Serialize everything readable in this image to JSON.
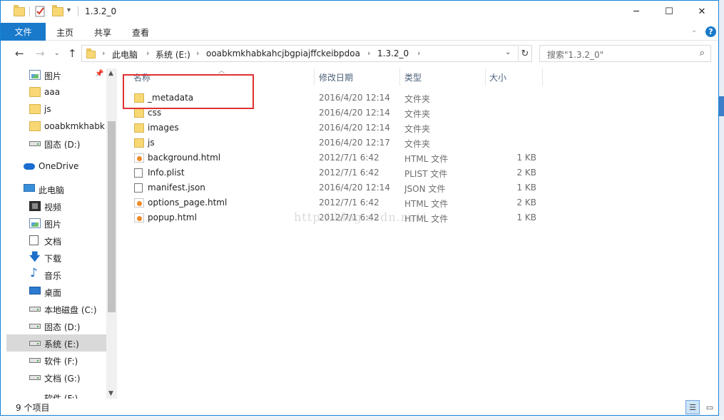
{
  "window": {
    "title": "1.3.2_0",
    "controls": {
      "minimize": "─",
      "maximize": "☐",
      "close": "✕"
    }
  },
  "ribbon": {
    "tabs": [
      "文件",
      "主页",
      "共享",
      "查看"
    ],
    "help": "?"
  },
  "address": {
    "crumbs": [
      "此电脑",
      "系统 (E:)",
      "ooabkmkhabkahcjbgpiajffckeibpdoa",
      "1.3.2_0"
    ]
  },
  "search": {
    "placeholder": "搜索\"1.3.2_0\""
  },
  "sidebar": {
    "items": [
      {
        "label": "图片",
        "icon": "pictures-icon",
        "pinned": true
      },
      {
        "label": "aaa",
        "icon": "folder-icon"
      },
      {
        "label": "js",
        "icon": "folder-icon"
      },
      {
        "label": "ooabkmkhabk",
        "icon": "folder-icon"
      },
      {
        "label": "固态 (D:)",
        "icon": "drive-icon"
      },
      {
        "label": "OneDrive",
        "icon": "onedrive-icon"
      },
      {
        "label": "此电脑",
        "icon": "this-pc-icon"
      },
      {
        "label": "视频",
        "icon": "videos-icon"
      },
      {
        "label": "图片",
        "icon": "pictures-icon"
      },
      {
        "label": "文档",
        "icon": "documents-icon"
      },
      {
        "label": "下载",
        "icon": "downloads-icon"
      },
      {
        "label": "音乐",
        "icon": "music-icon"
      },
      {
        "label": "桌面",
        "icon": "desktop-icon"
      },
      {
        "label": "本地磁盘 (C:)",
        "icon": "drive-icon"
      },
      {
        "label": "固态 (D:)",
        "icon": "drive-icon"
      },
      {
        "label": "系统 (E:)",
        "icon": "drive-icon",
        "selected": true
      },
      {
        "label": "软件 (F:)",
        "icon": "drive-icon"
      },
      {
        "label": "文档 (G:)",
        "icon": "drive-icon"
      },
      {
        "label": "软件 (F:)",
        "icon": "drive-icon"
      }
    ]
  },
  "columns": {
    "name": "名称",
    "date": "修改日期",
    "type": "类型",
    "size": "大小"
  },
  "files": [
    {
      "name": "_metadata",
      "date": "2016/4/20 12:14",
      "type": "文件夹",
      "size": "",
      "kind": "folder"
    },
    {
      "name": "css",
      "date": "2016/4/20 12:14",
      "type": "文件夹",
      "size": "",
      "kind": "folder"
    },
    {
      "name": "images",
      "date": "2016/4/20 12:14",
      "type": "文件夹",
      "size": "",
      "kind": "folder"
    },
    {
      "name": "js",
      "date": "2016/4/20 12:17",
      "type": "文件夹",
      "size": "",
      "kind": "folder"
    },
    {
      "name": "background.html",
      "date": "2012/7/1 6:42",
      "type": "HTML 文件",
      "size": "1 KB",
      "kind": "html"
    },
    {
      "name": "Info.plist",
      "date": "2012/7/1 6:42",
      "type": "PLIST 文件",
      "size": "2 KB",
      "kind": "file"
    },
    {
      "name": "manifest.json",
      "date": "2016/4/20 12:14",
      "type": "JSON 文件",
      "size": "1 KB",
      "kind": "file"
    },
    {
      "name": "options_page.html",
      "date": "2012/7/1 6:42",
      "type": "HTML 文件",
      "size": "2 KB",
      "kind": "html"
    },
    {
      "name": "popup.html",
      "date": "2012/7/1 6:42",
      "type": "HTML 文件",
      "size": "1 KB",
      "kind": "html"
    }
  ],
  "watermark": "http://blog.csdn.net/",
  "status": {
    "item_count": "9 个项目"
  },
  "colors": {
    "accent": "#1979ca",
    "highlight_box": "#e03131"
  }
}
